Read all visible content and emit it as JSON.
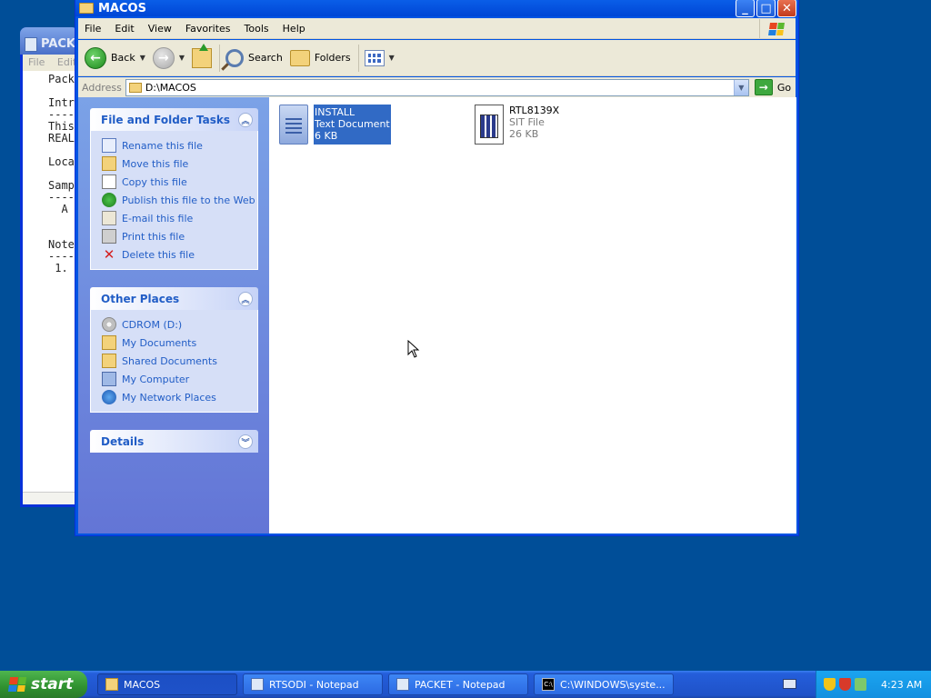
{
  "background_notepad": {
    "title": "PACK",
    "menu": [
      "File",
      "Edit"
    ],
    "lines": [
      "Pack",
      "",
      "Intr",
      "----",
      "This",
      "REAL",
      "",
      "Loca",
      "",
      "Samp",
      "----",
      "  A",
      "",
      "",
      "Note",
      "----",
      " 1."
    ]
  },
  "window": {
    "title": "MACOS",
    "menu": [
      "File",
      "Edit",
      "View",
      "Favorites",
      "Tools",
      "Help"
    ],
    "toolbar": {
      "back": "Back",
      "search": "Search",
      "folders": "Folders"
    },
    "address": {
      "label": "Address",
      "value": "D:\\MACOS",
      "go": "Go"
    }
  },
  "taskpane": {
    "file_tasks": {
      "title": "File and Folder Tasks",
      "items": [
        {
          "label": "Rename this file",
          "icon": "rename-icon"
        },
        {
          "label": "Move this file",
          "icon": "move-icon"
        },
        {
          "label": "Copy this file",
          "icon": "copy-icon"
        },
        {
          "label": "Publish this file to the Web",
          "icon": "publish-icon"
        },
        {
          "label": "E-mail this file",
          "icon": "email-icon"
        },
        {
          "label": "Print this file",
          "icon": "print-icon"
        },
        {
          "label": "Delete this file",
          "icon": "delete-icon"
        }
      ]
    },
    "other_places": {
      "title": "Other Places",
      "items": [
        {
          "label": "CDROM (D:)",
          "icon": "cdrom-icon"
        },
        {
          "label": "My Documents",
          "icon": "my-documents-icon"
        },
        {
          "label": "Shared Documents",
          "icon": "shared-documents-icon"
        },
        {
          "label": "My Computer",
          "icon": "my-computer-icon"
        },
        {
          "label": "My Network Places",
          "icon": "network-places-icon"
        }
      ]
    },
    "details": {
      "title": "Details"
    }
  },
  "files": [
    {
      "name": "INSTALL",
      "type": "Text Document",
      "size": "6 KB",
      "selected": true,
      "icon": "text-document-icon"
    },
    {
      "name": "RTL8139X",
      "type": "SIT File",
      "size": "26 KB",
      "selected": false,
      "icon": "sit-file-icon"
    }
  ],
  "taskbar": {
    "start": "start",
    "buttons": [
      {
        "label": "MACOS",
        "active": true
      },
      {
        "label": "RTSODI - Notepad",
        "active": false
      },
      {
        "label": "PACKET - Notepad",
        "active": false
      },
      {
        "label": "C:\\WINDOWS\\syste...",
        "active": false
      }
    ],
    "clock": "4:23 AM"
  }
}
